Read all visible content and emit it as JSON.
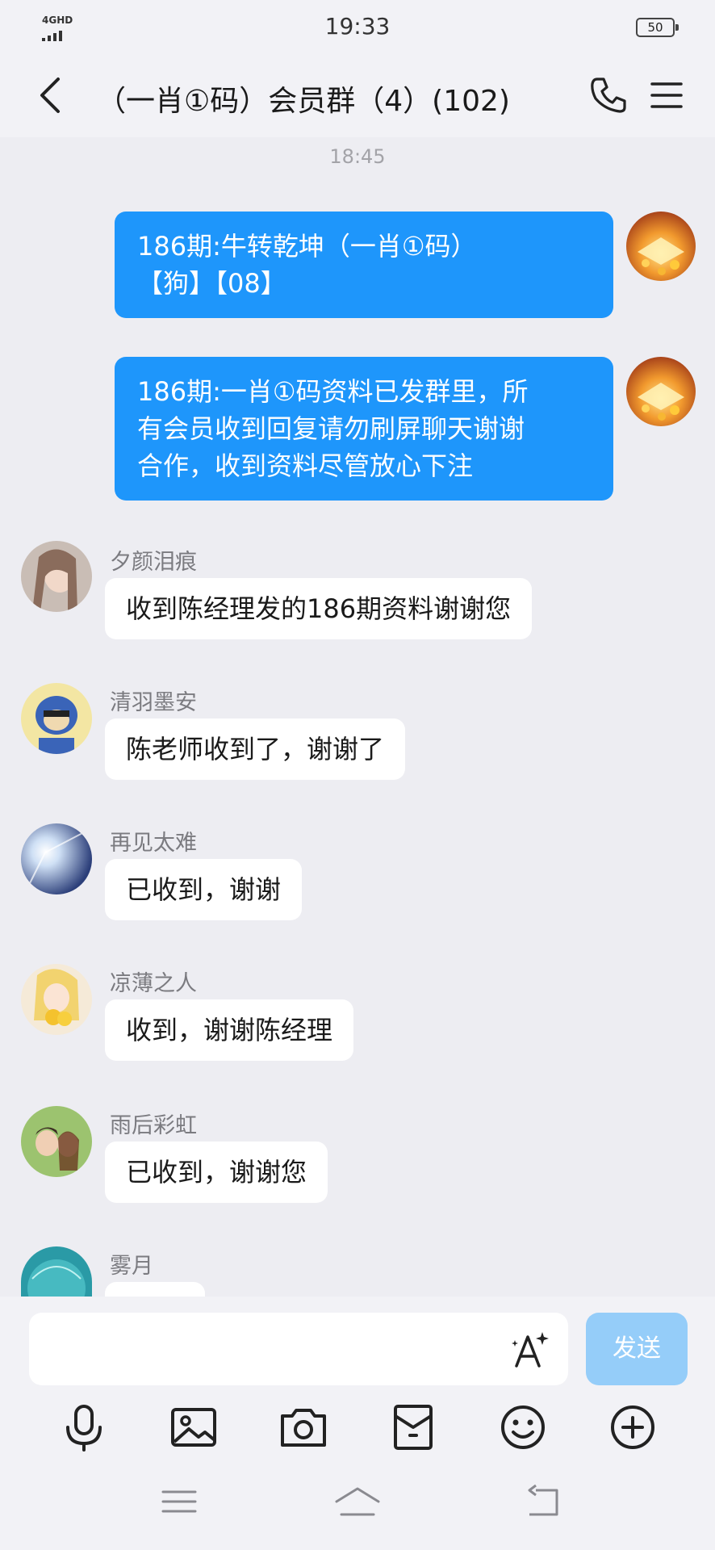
{
  "status_bar": {
    "network": "4GHD",
    "time": "19:33",
    "battery": "50"
  },
  "header": {
    "title": "（一肖①码）会员群（4）(102)"
  },
  "timestamp": "18:45",
  "outgoing": [
    {
      "lines": [
        "186期:牛转乾坤（一肖①码）",
        "【狗】【08】"
      ]
    },
    {
      "lines": [
        "186期:一肖①码资料已发群里，所",
        "有会员收到回复请勿刷屏聊天谢谢",
        "合作，收到资料尽管放心下注"
      ]
    }
  ],
  "incoming": [
    {
      "sender": "夕颜泪痕",
      "text": "收到陈经理发的186期资料谢谢您"
    },
    {
      "sender": "清羽墨安",
      "text": "陈老师收到了，谢谢了"
    },
    {
      "sender": "再见太难",
      "text": "已收到，谢谢"
    },
    {
      "sender": "凉薄之人",
      "text": "收到，谢谢陈经理"
    },
    {
      "sender": "雨后彩虹",
      "text": "已收到，谢谢您"
    },
    {
      "sender": "雾月",
      "text": ""
    }
  ],
  "composer": {
    "placeholder": "",
    "send_label": "发送"
  },
  "colors": {
    "accent": "#1e96fb",
    "send_disabled": "#95cdf9",
    "background": "#ededf2"
  }
}
